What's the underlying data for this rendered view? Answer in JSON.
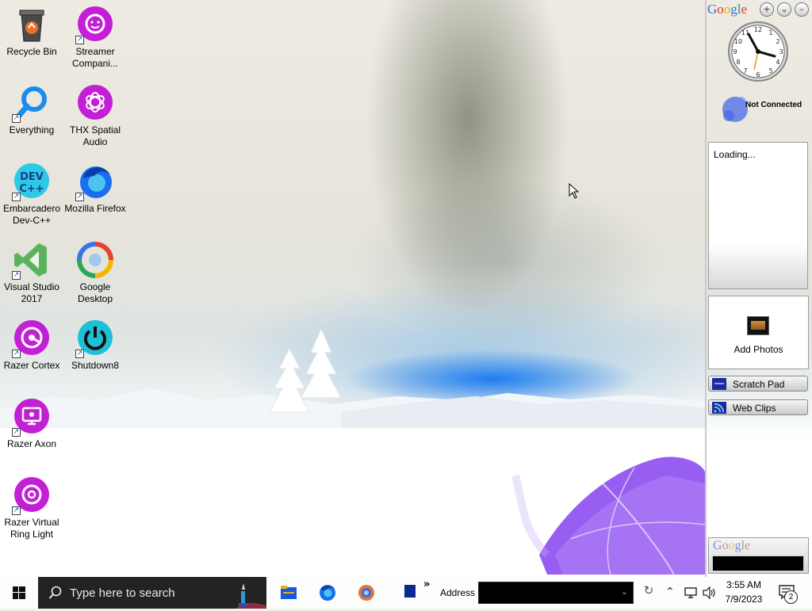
{
  "desktop": {
    "icons": [
      {
        "label": "Recycle Bin",
        "icon": "recycle-bin-icon"
      },
      {
        "label": "Streamer Compani...",
        "icon": "streamer-companion-icon"
      },
      {
        "label": "Everything",
        "icon": "everything-search-icon"
      },
      {
        "label": "THX Spatial Audio",
        "icon": "thx-spatial-audio-icon"
      },
      {
        "label": "Embarcadero Dev-C++",
        "icon": "dev-cpp-icon"
      },
      {
        "label": "Mozilla Firefox",
        "icon": "firefox-icon"
      },
      {
        "label": "Visual Studio 2017",
        "icon": "visual-studio-icon"
      },
      {
        "label": "Google Desktop",
        "icon": "google-desktop-icon"
      },
      {
        "label": "Razer Cortex",
        "icon": "razer-cortex-icon"
      },
      {
        "label": "Shutdown8",
        "icon": "shutdown8-icon"
      },
      {
        "label": "Razer Axon",
        "icon": "razer-axon-icon"
      },
      {
        "label": "Razer Virtual Ring Light",
        "icon": "razer-ring-light-icon"
      }
    ]
  },
  "sidebar": {
    "logo": "Google",
    "buttons": {
      "add": "+",
      "menu": "⌄",
      "minimize": "–"
    },
    "talk_status": "Not Connected",
    "news_text": "Loading...",
    "photos_label": "Add Photos",
    "scratch_pad_label": "Scratch Pad",
    "web_clips_label": "Web Clips",
    "search_logo": "Google"
  },
  "taskbar": {
    "search_placeholder": "Type here to search",
    "toolbar_chevron": "»",
    "address_label": "Address",
    "address_value": "",
    "time": "3:55 AM",
    "date": "7/9/2023",
    "notification_count": "2",
    "pinned": [
      "file-explorer-icon",
      "firefox-icon",
      "google-desktop-icon",
      "app-icon"
    ]
  },
  "colors": {
    "razer_magenta": "#c21fd6",
    "taskbar": "#fdfdfd",
    "search_box": "#232323",
    "accent_blue": "#1a6ef0"
  }
}
